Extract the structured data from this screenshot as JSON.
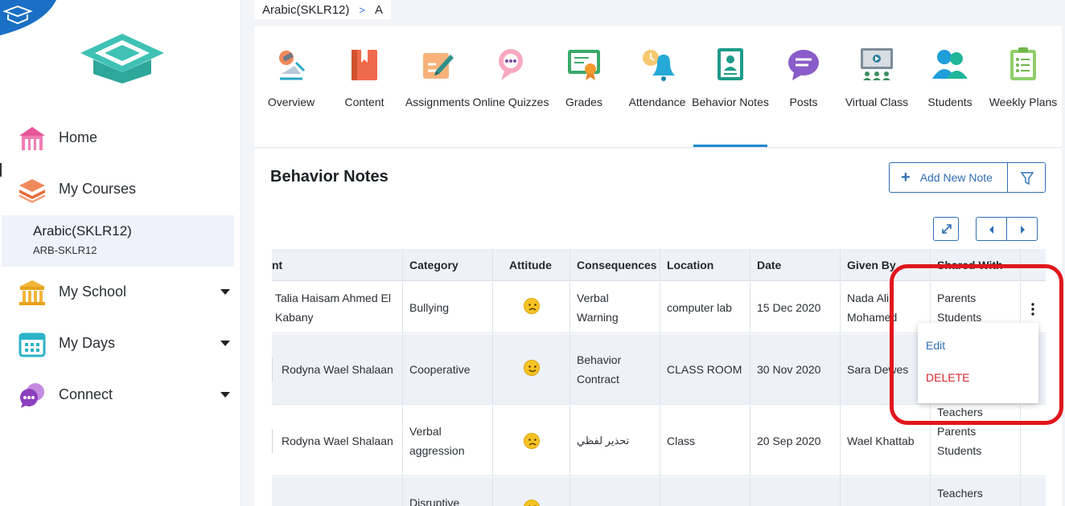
{
  "breadcrumb": {
    "course": "Arabic(SKLR12)",
    "separator": ">",
    "current": "A"
  },
  "sidebar": {
    "home": "Home",
    "my_courses": "My Courses",
    "course": {
      "name": "Arabic(SKLR12)",
      "code": "ARB-SKLR12"
    },
    "my_school": "My School",
    "my_days": "My Days",
    "connect": "Connect"
  },
  "tabs": [
    {
      "label": "Overview",
      "icon": "overview-icon"
    },
    {
      "label": "Content",
      "icon": "book-icon"
    },
    {
      "label": "Assignments",
      "icon": "assignment-icon"
    },
    {
      "label": "Online Quizzes",
      "icon": "quiz-chat-icon"
    },
    {
      "label": "Grades",
      "icon": "certificate-icon"
    },
    {
      "label": "Attendance",
      "icon": "bell-icon"
    },
    {
      "label": "Behavior Notes",
      "icon": "id-badge-icon",
      "active": true
    },
    {
      "label": "Posts",
      "icon": "speech-bubble-icon"
    },
    {
      "label": "Virtual Class",
      "icon": "virtual-class-icon"
    },
    {
      "label": "Students",
      "icon": "students-icon"
    },
    {
      "label": "Weekly Plans",
      "icon": "clipboard-icon"
    }
  ],
  "main": {
    "title": "Behavior Notes",
    "add_label": "Add New Note"
  },
  "table": {
    "headers": [
      "nt",
      "Category",
      "Attitude",
      "Consequences",
      "Location",
      "Date",
      "Given By",
      "Shared With"
    ],
    "rows": [
      {
        "student": "Talia Haisam Ahmed El Kabany",
        "category": "Bullying",
        "attitude": "negative",
        "consequences": "Verbal Warning",
        "location": "computer lab",
        "date": "15 Dec 2020",
        "given_by": "Nada Ali Mohamed",
        "shared_1": "Parents",
        "shared_2": "Students"
      },
      {
        "student": "Rodyna Wael Shalaan",
        "category": "Cooperative",
        "attitude": "positive",
        "consequences": "Behavior Contract",
        "location": "CLASS ROOM",
        "date": "30 Nov 2020",
        "given_by": "Sara Dewes",
        "shared_1": "",
        "shared_2": ""
      },
      {
        "student": "Rodyna Wael Shalaan",
        "category": "Verbal aggression",
        "attitude": "negative",
        "consequences": "تحذير لفظي",
        "location": "Class",
        "date": "20 Sep 2020",
        "given_by": "Wael Khattab",
        "shared_1": "Teachers",
        "shared_2": "Parents",
        "shared_3": "Students"
      },
      {
        "category": "Disruptive",
        "attitude": "negative",
        "shared_1": "Teachers"
      }
    ]
  },
  "menu": {
    "edit": "Edit",
    "delete": "DELETE"
  },
  "colors": {
    "accent": "#1e88d0",
    "button": "#2f6fb6",
    "delete": "#d9262c",
    "highlight": "#e0161d"
  }
}
